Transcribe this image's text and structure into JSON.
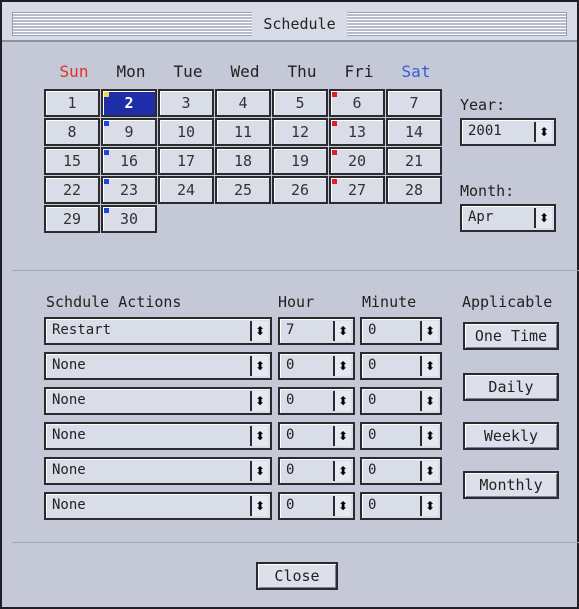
{
  "window": {
    "title": "Schedule"
  },
  "calendar": {
    "weekdays": [
      "Sun",
      "Mon",
      "Tue",
      "Wed",
      "Thu",
      "Fri",
      "Sat"
    ],
    "days": [
      {
        "label": "1",
        "marker": null
      },
      {
        "label": "2",
        "marker": "#f2d44a",
        "selected": true
      },
      {
        "label": "3",
        "marker": null
      },
      {
        "label": "4",
        "marker": null
      },
      {
        "label": "5",
        "marker": null
      },
      {
        "label": "6",
        "marker": "#e02020"
      },
      {
        "label": "7",
        "marker": null
      },
      {
        "label": "8",
        "marker": null
      },
      {
        "label": "9",
        "marker": "#1f44e0"
      },
      {
        "label": "10",
        "marker": null
      },
      {
        "label": "11",
        "marker": null
      },
      {
        "label": "12",
        "marker": null
      },
      {
        "label": "13",
        "marker": "#e02020"
      },
      {
        "label": "14",
        "marker": null
      },
      {
        "label": "15",
        "marker": null
      },
      {
        "label": "16",
        "marker": "#1f44e0"
      },
      {
        "label": "17",
        "marker": null
      },
      {
        "label": "18",
        "marker": null
      },
      {
        "label": "19",
        "marker": null
      },
      {
        "label": "20",
        "marker": "#e02020"
      },
      {
        "label": "21",
        "marker": null
      },
      {
        "label": "22",
        "marker": null
      },
      {
        "label": "23",
        "marker": "#1f44e0"
      },
      {
        "label": "24",
        "marker": null
      },
      {
        "label": "25",
        "marker": null
      },
      {
        "label": "26",
        "marker": null
      },
      {
        "label": "27",
        "marker": "#e02020"
      },
      {
        "label": "28",
        "marker": null
      },
      {
        "label": "29",
        "marker": null
      },
      {
        "label": "30",
        "marker": "#1f44e0"
      }
    ]
  },
  "year": {
    "label": "Year:",
    "value": "2001"
  },
  "month": {
    "label": "Month:",
    "value": "Apr"
  },
  "actions": {
    "headers": {
      "action": "Schdule Actions",
      "hour": "Hour",
      "minute": "Minute",
      "applicable": "Applicable"
    },
    "rows": [
      {
        "action": "Restart",
        "hour": "7",
        "minute": "0"
      },
      {
        "action": "None",
        "hour": "0",
        "minute": "0"
      },
      {
        "action": "None",
        "hour": "0",
        "minute": "0"
      },
      {
        "action": "None",
        "hour": "0",
        "minute": "0"
      },
      {
        "action": "None",
        "hour": "0",
        "minute": "0"
      },
      {
        "action": "None",
        "hour": "0",
        "minute": "0"
      }
    ],
    "applicable_buttons": [
      "One Time",
      "Daily",
      "Weekly",
      "Monthly"
    ]
  },
  "footer": {
    "close_label": "Close"
  },
  "colors": {
    "sunday": "#e03124",
    "saturday": "#3a5ad3",
    "selected_bg": "#1d2ea8"
  }
}
